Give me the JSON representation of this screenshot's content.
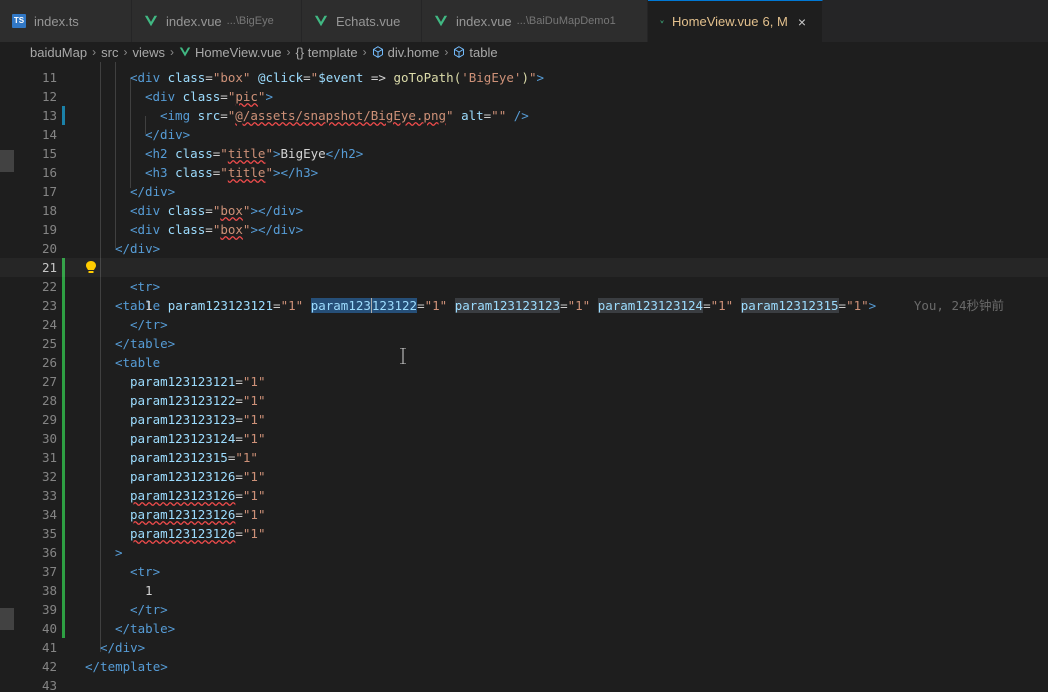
{
  "tabs": [
    {
      "label": "index.ts",
      "desc": "",
      "icon": "typescript-icon",
      "active": false
    },
    {
      "label": "index.vue",
      "desc": "...\\BigEye",
      "icon": "vue-icon",
      "active": false
    },
    {
      "label": "Echats.vue",
      "desc": "",
      "icon": "vue-icon",
      "active": false
    },
    {
      "label": "index.vue",
      "desc": "...\\BaiDuMapDemo1",
      "icon": "vue-icon",
      "active": false
    },
    {
      "label": "HomeView.vue",
      "desc": "6, M",
      "icon": "vue-icon",
      "active": true
    }
  ],
  "close_glyph": "×",
  "breadcrumb": [
    "baiduMap",
    "src",
    "views",
    "HomeView.vue",
    "{} template",
    "div.home",
    "table"
  ],
  "ghost_blame": "You, 24秒钟前",
  "colors": {
    "accent": "#0078d4",
    "tag": "#569cd6",
    "attr": "#9cdcfe",
    "string": "#ce9178",
    "added": "#2ea043"
  }
}
